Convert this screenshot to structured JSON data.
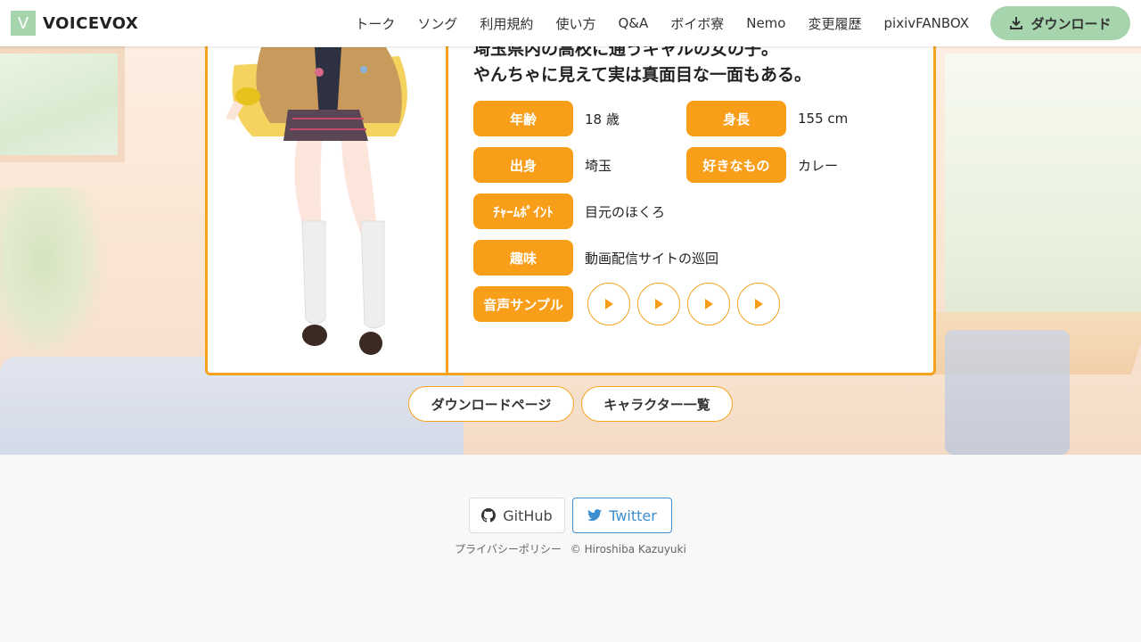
{
  "navbar": {
    "brand_mark": "V",
    "brand": "VOICEVOX",
    "links": [
      "トーク",
      "ソング",
      "利用規約",
      "使い方",
      "Q&A",
      "ボイボ寮",
      "Nemo",
      "変更履歴",
      "pixivFANBOX"
    ],
    "download": "ダウンロード"
  },
  "character": {
    "description_lines": [
      "埼玉県内の高校に通うギャルの女の子。",
      "やんちゃに見えて実は真面目な一面もある。"
    ],
    "profile": {
      "age_label": "年齢",
      "age": "18 歳",
      "height_label": "身長",
      "height": "155 cm",
      "origin_label": "出身",
      "origin": "埼玉",
      "favorite_label": "好きなもの",
      "favorite": "カレー",
      "charm_label": "ﾁｬｰﾑﾎﾟｲﾝﾄ",
      "charm": "目元のほくろ",
      "hobby_label": "趣味",
      "hobby": "動画配信サイトの巡回",
      "voice_label": "音声サンプル"
    },
    "voice_samples": 4
  },
  "links": {
    "download_page": "ダウンロードページ",
    "character_list": "キャラクター一覧"
  },
  "footer": {
    "github": "GitHub",
    "twitter": "Twitter",
    "privacy": "プライバシーポリシー",
    "copyright": "© Hiroshiba Kazuyuki"
  },
  "colors": {
    "accent": "#f99e19",
    "border": "#f6a21d",
    "brand": "#a5d4ad",
    "twitter": "#3d8ecf"
  }
}
